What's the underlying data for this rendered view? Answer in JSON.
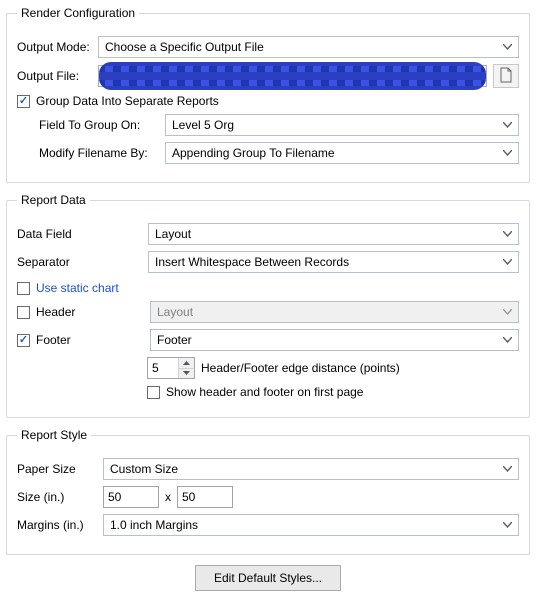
{
  "render": {
    "legend": "Render Configuration",
    "outputModeLabel": "Output Mode:",
    "outputMode": "Choose a Specific Output File",
    "outputFileLabel": "Output File:",
    "groupDataLabel": "Group Data Into Separate Reports",
    "fieldToGroupLabel": "Field To Group On:",
    "fieldToGroup": "Level 5 Org",
    "modifyFilenameLabel": "Modify Filename By:",
    "modifyFilename": "Appending Group To Filename"
  },
  "data": {
    "legend": "Report Data",
    "dataFieldLabel": "Data Field",
    "dataField": "Layout",
    "separatorLabel": "Separator",
    "separator": "Insert Whitespace Between Records",
    "useStaticChart": "Use static chart",
    "headerLabel": "Header",
    "header": "Layout",
    "footerLabel": "Footer",
    "footer": "Footer",
    "edgeDistValue": "5",
    "edgeDistLabel": "Header/Footer edge distance (points)",
    "showFirstPage": "Show header and footer on first page"
  },
  "style": {
    "legend": "Report Style",
    "paperSizeLabel": "Paper Size",
    "paperSize": "Custom Size",
    "sizeLabel": "Size (in.)",
    "width": "50",
    "by": "x",
    "height": "50",
    "marginsLabel": "Margins (in.)",
    "margins": "1.0 inch Margins"
  },
  "editStylesBtn": "Edit Default Styles..."
}
